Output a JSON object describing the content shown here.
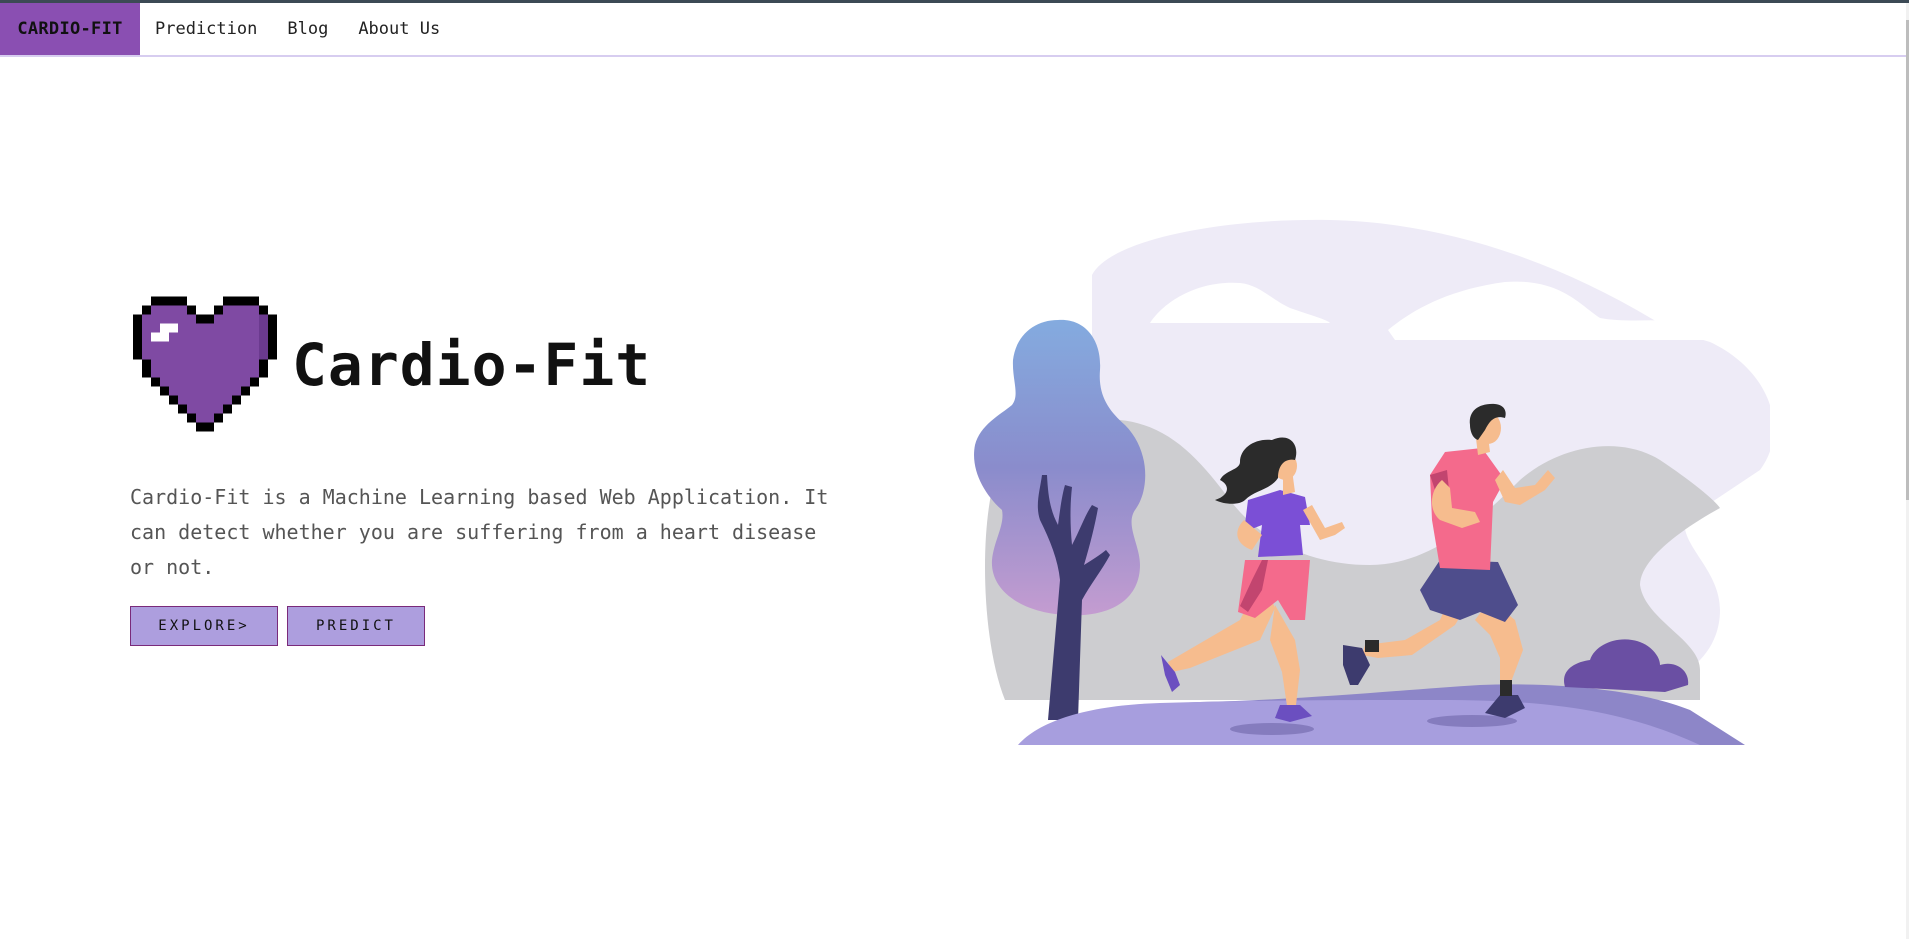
{
  "navbar": {
    "brand": "CARDIO-FIT",
    "links": [
      "Prediction",
      "Blog",
      "About Us"
    ]
  },
  "hero": {
    "title": "Cardio-Fit",
    "description": "Cardio-Fit is a Machine Learning based Web Application. It can detect whether you are suffering from a heart disease or not.",
    "buttons": {
      "explore": "EXPLORE>",
      "predict": "PREDICT"
    },
    "logo_icon": "pixel-heart-icon",
    "illustration": "couple-jogging-illustration"
  },
  "colors": {
    "brand": "#8a4fb2",
    "button_fill": "#ad9ede",
    "button_border": "#7a2a7a",
    "heart": "#7f4aa3"
  }
}
